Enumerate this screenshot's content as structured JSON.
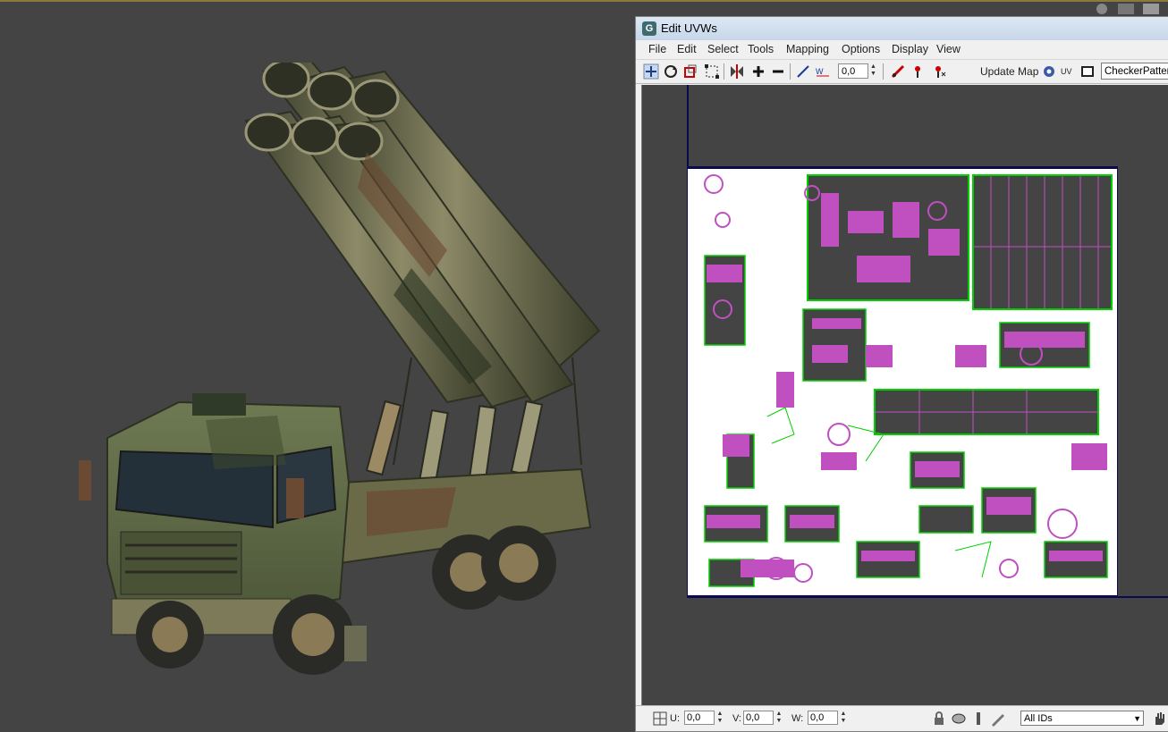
{
  "window": {
    "title": "Edit UVWs",
    "app_icon": "G"
  },
  "menu": {
    "items": [
      "File",
      "Edit",
      "Select",
      "Tools",
      "Mapping",
      "Options",
      "Display",
      "View"
    ]
  },
  "toolbar": {
    "icons": [
      "move-icon",
      "rotate-icon",
      "scale-icon",
      "freeform-icon",
      "mirror-icon",
      "expand-selection-icon",
      "contract-selection-icon",
      "soft-selection-icon",
      "weld-icon",
      "break-icon",
      "pin-icon",
      "unpin-icon"
    ],
    "rotation_value": "0,0",
    "update_map_label": "Update Map",
    "texture_select": "CheckerPattern"
  },
  "statusbar": {
    "u_label": "U:",
    "u_value": "0,0",
    "v_label": "V:",
    "v_value": "0,0",
    "w_label": "W:",
    "w_value": "0,0",
    "ids_select": "All IDs",
    "icons": [
      "grid-snap-icon",
      "lock-selection-icon",
      "display-mode-icon",
      "filter-icon",
      "pan-hand-icon"
    ]
  },
  "colors": {
    "viewport_bg": "#444444",
    "uv_lines": "#ffffff",
    "uv_faces": "#c050c0",
    "uv_seams": "#00d000",
    "uv_border": "#0a0a50",
    "truck_camo": "#5f6b45"
  }
}
